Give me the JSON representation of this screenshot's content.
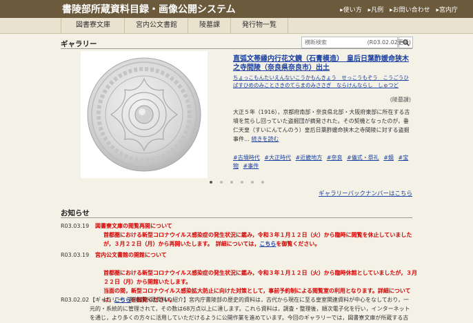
{
  "header": {
    "title": "書陵部所蔵資料目録・画像公開システム",
    "links": [
      "使い方",
      "凡例",
      "お問い合わせ",
      "宮内庁"
    ]
  },
  "nav": {
    "items": [
      "図書寮文庫",
      "宮内公文書館",
      "陵墓課",
      "発行物一覧"
    ],
    "search_placeholder": "横断検索"
  },
  "gallery": {
    "heading": "ギャラリー",
    "updated": "(R03.02.02更新)",
    "title": "直弧文帯縁内行花文鏡（石膏模造）　皇后日葉酢媛命狭木之寺間陵（奈良県奈良市）出土",
    "reading": "ちょっこもんたいえんないこうかもんきょう　せっこうもぞう　こうごうひばすひめのみことさきのてらまのみささぎ　ならけんならし　しゅつど",
    "owner": "(陵墓課)",
    "description": "大正５年（1916），京都府南部・奈良県北部・大阪府東部に所在する古墳を荒らし回っていた盗掘団が摘発された。その契機となったのが，垂仁天皇（すいにんてんのう）皇后日葉酢媛命狭木之寺間陵に対する盗掘事件…",
    "read_more": "続きを読む",
    "tags": [
      "#古墳時代",
      "#大正時代",
      "#近畿地方",
      "#奈良",
      "#儀式・祭礼",
      "#鏡",
      "#宝物",
      "#事件"
    ],
    "backnumber": "ギャラリーバックナンバーはこちら",
    "slide_count": 6,
    "active_slide": 1
  },
  "news": {
    "heading": "お知らせ",
    "items": [
      {
        "date": "R03.03.19",
        "title": "図書寮文庫の閲覧再開について",
        "body_pre": "首都圏における新型コロナウイルス感染症の発生状況に鑑み，令和３年１月１２日（火）から臨時に閲覧を休止していましたが，３月２２日（月）から再開いたします。　詳細については，",
        "link": "こちら",
        "body_post": "を御覧ください。"
      },
      {
        "date": "R03.03.19",
        "title": "宮内公文書館の開館について",
        "body_pre": "首都圏における新型コロナウイルス感染症の発生状況に鑑み，令和３年１月１２日（火）から臨時休館としていましたが，３月２２日（月）から開館いたします。\n当面の間，新型コロナウイルス感染拡大防止に向けた対策として，事前予約制による閲覧室の利用となります。詳細については，",
        "link": "こちら",
        "body_post": "を御覧ください。"
      },
      {
        "date": "R03.02.02",
        "body": "【ギャラリー：書陵部所蔵資料の紹介】宮内庁書陵部の歴史的資料は，古代から現在に至る皇室関連資料が中心をなしており，一元的・系統的に管理されて，その数は68万点以上に達します。これら資料は，調査・整理後，順次電子化を行い，インターネットを通じ，より多くの方々に活用していただけるように公開作業を進めています。今回のギャラリーでは，図書寮文庫が所蔵する古典籍のうち..."
      }
    ]
  },
  "colors": {
    "header_bg": "#6b5a3c",
    "nav_bg": "#e8e2cf",
    "page_bg": "#f4f1e6",
    "link": "#1a3fa0",
    "alert": "#d40000"
  }
}
